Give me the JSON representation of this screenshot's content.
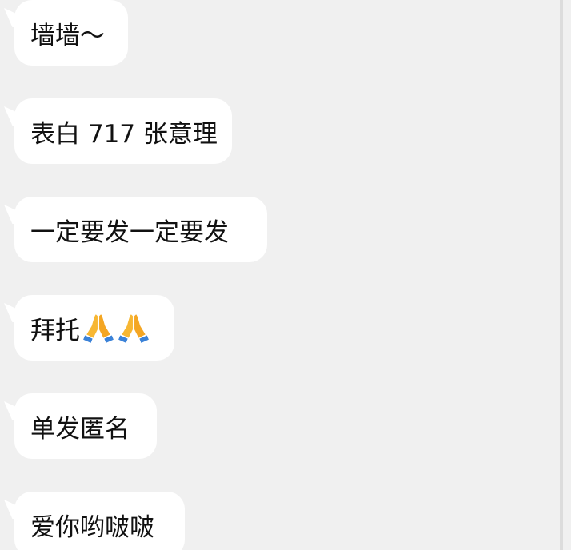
{
  "chat": {
    "messages": [
      {
        "text": "墙墙～",
        "emoji": []
      },
      {
        "text": "表白 717 张意理",
        "emoji": []
      },
      {
        "text": "一定要发一定要发",
        "emoji": []
      },
      {
        "text": "拜托",
        "emoji": [
          "folded-hands-icon",
          "folded-hands-icon"
        ]
      },
      {
        "text": "单发匿名",
        "emoji": []
      },
      {
        "text": "爱你哟啵啵",
        "emoji": []
      }
    ]
  },
  "colors": {
    "background": "#f0f0f0",
    "bubble": "#ffffff",
    "text": "#111111",
    "emoji_skin": "#f7b733",
    "emoji_sleeve": "#3b82d8"
  }
}
